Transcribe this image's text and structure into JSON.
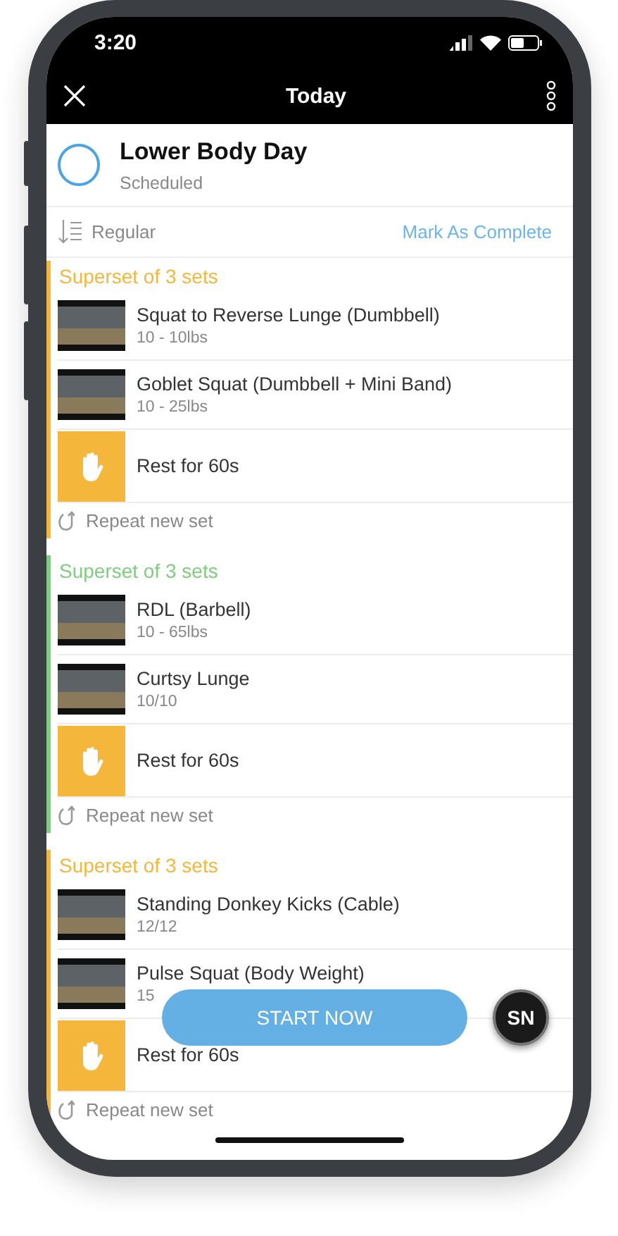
{
  "status_bar": {
    "time": "3:20"
  },
  "nav": {
    "title": "Today"
  },
  "workout": {
    "title": "Lower Body Day",
    "status": "Scheduled",
    "completed": false
  },
  "order": {
    "label": "Regular",
    "action": "Mark As Complete"
  },
  "sections": [
    {
      "title": "Superset of 3 sets",
      "color": "#f5b73b",
      "repeat": "Repeat new set",
      "items": [
        {
          "kind": "exercise",
          "name": "Squat to Reverse Lunge (Dumbbell)",
          "detail": "10 - 10lbs"
        },
        {
          "kind": "exercise",
          "name": "Goblet Squat (Dumbbell + Mini Band)",
          "detail": "10 - 25lbs"
        },
        {
          "kind": "rest",
          "name": "Rest for 60s"
        }
      ]
    },
    {
      "title": "Superset of 3 sets",
      "color": "#7fce80",
      "repeat": "Repeat new set",
      "items": [
        {
          "kind": "exercise",
          "name": "RDL (Barbell)",
          "detail": "10 - 65lbs"
        },
        {
          "kind": "exercise",
          "name": "Curtsy Lunge",
          "detail": "10/10"
        },
        {
          "kind": "rest",
          "name": "Rest for 60s"
        }
      ]
    },
    {
      "title": "Superset of 3 sets",
      "color": "#f5b73b",
      "repeat": "Repeat new set",
      "items": [
        {
          "kind": "exercise",
          "name": "Standing Donkey Kicks (Cable)",
          "detail": "12/12"
        },
        {
          "kind": "exercise",
          "name": "Pulse Squat (Body Weight)",
          "detail": "15"
        },
        {
          "kind": "rest",
          "name": "Rest for 60s"
        }
      ]
    }
  ],
  "start_button": "START NOW",
  "logo_badge": "SN"
}
